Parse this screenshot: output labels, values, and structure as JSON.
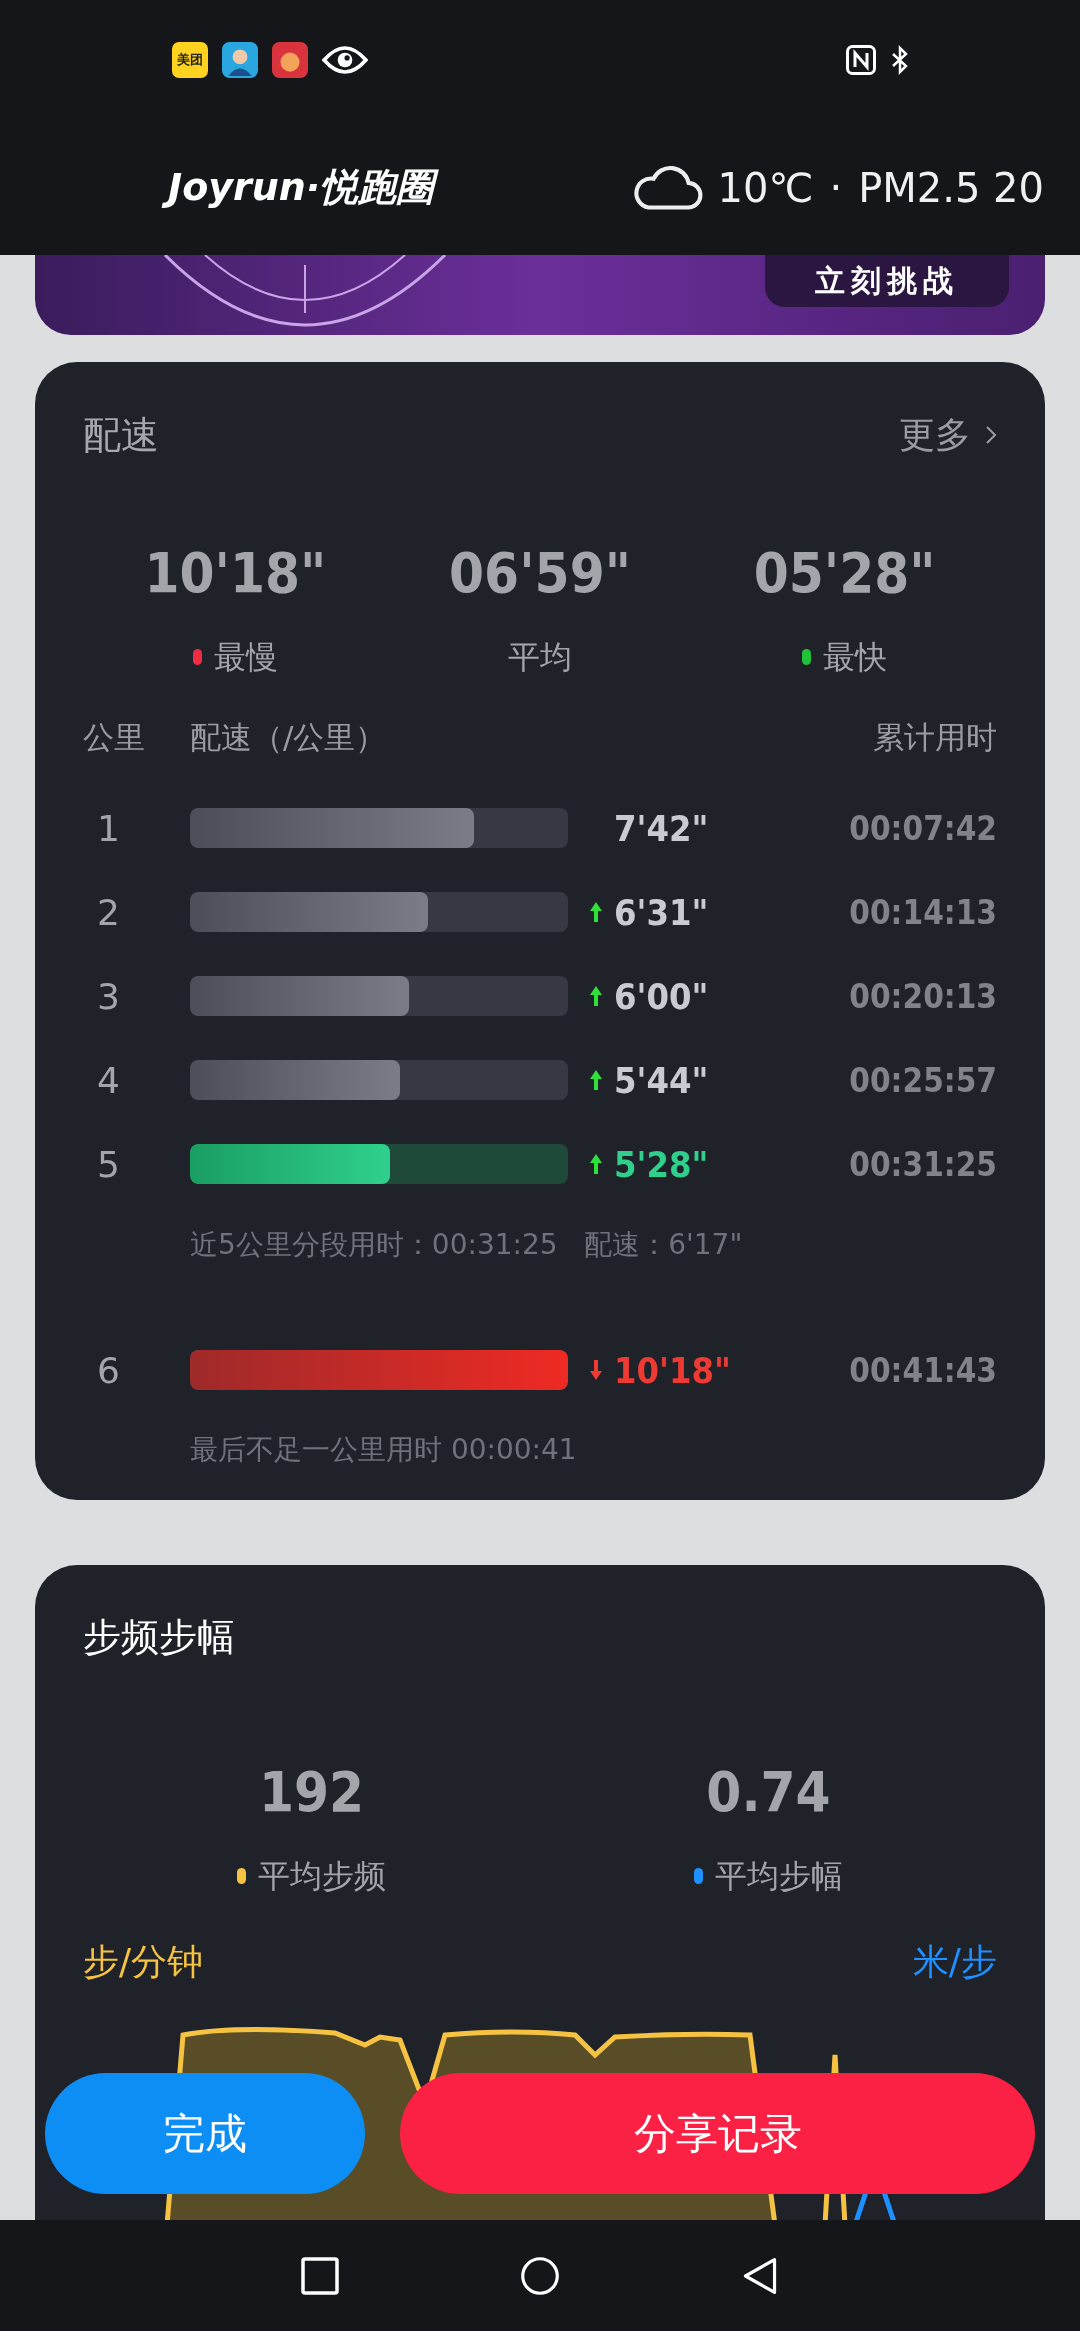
{
  "status_bar": {
    "app_badge": "美团"
  },
  "header": {
    "logo": "Joyrun·悦跑圈",
    "temperature": "10℃",
    "separator": "·",
    "air_quality": "PM2.5 20"
  },
  "banner": {
    "button": "立刻挑战"
  },
  "pace": {
    "title": "配速",
    "more": "更多",
    "summary": [
      {
        "value": "10'18\"",
        "label": "最慢",
        "kind": "slowest"
      },
      {
        "value": "06'59\"",
        "label": "平均",
        "kind": "average"
      },
      {
        "value": "05'28\"",
        "label": "最快",
        "kind": "fastest"
      }
    ],
    "columns": [
      "公里",
      "配速（/公里）",
      "累计用时"
    ],
    "groups": [
      {
        "rows": [
          {
            "km": "1",
            "pace": "7'42\"",
            "total": "00:07:42",
            "level": 0.75,
            "kind": "normal",
            "faster": false,
            "slower": false
          },
          {
            "km": "2",
            "pace": "6'31\"",
            "total": "00:14:13",
            "level": 0.63,
            "kind": "normal",
            "faster": true,
            "slower": false
          },
          {
            "km": "3",
            "pace": "6'00\"",
            "total": "00:20:13",
            "level": 0.58,
            "kind": "normal",
            "faster": true,
            "slower": false
          },
          {
            "km": "4",
            "pace": "5'44\"",
            "total": "00:25:57",
            "level": 0.555,
            "kind": "normal",
            "faster": true,
            "slower": false
          },
          {
            "km": "5",
            "pace": "5'28\"",
            "total": "00:31:25",
            "level": 0.53,
            "kind": "fastest",
            "faster": true,
            "slower": false
          }
        ],
        "note": "近5公里分段用时：00:31:25   配速：6'17\""
      },
      {
        "rows": [
          {
            "km": "6",
            "pace": "10'18\"",
            "total": "00:41:43",
            "level": 1.0,
            "kind": "slowest",
            "faster": false,
            "slower": true
          }
        ],
        "note": "最后不足一公里用时 00:00:41"
      }
    ]
  },
  "cadence": {
    "title": "步频步幅",
    "stats": [
      {
        "value": "192",
        "label": "平均步频",
        "color": "#f5c242"
      },
      {
        "value": "0.74",
        "label": "平均步幅",
        "color": "#1e90ff"
      }
    ],
    "left_unit": "步/分钟",
    "right_unit": "米/步"
  },
  "buttons": [
    {
      "label": "完成",
      "kind": "secondary"
    },
    {
      "label": "分享记录",
      "kind": "primary"
    }
  ]
}
